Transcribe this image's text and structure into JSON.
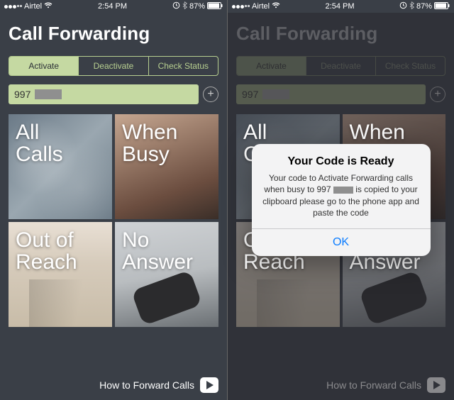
{
  "status": {
    "carrier": "Airtel",
    "time": "2:54 PM",
    "battery": "87%",
    "wifi_icon": "wifi",
    "bt_icon": "bluetooth"
  },
  "title": "Call Forwarding",
  "segments": {
    "activate": "Activate",
    "deactivate": "Deactivate",
    "check": "Check Status"
  },
  "input": {
    "value": "997",
    "plus": "+"
  },
  "tiles": {
    "all": "All\nCalls",
    "busy": "When\nBusy",
    "out": "Out of\nReach",
    "no": "No\nAnswer"
  },
  "footer": {
    "link": "How to Forward Calls"
  },
  "alert": {
    "title": "Your Code is Ready",
    "body_pre": "Your code to Activate Forwarding calls when busy to 997",
    "body_post": "is copied to your clipboard please go to the phone app and paste the code",
    "ok": "OK"
  }
}
